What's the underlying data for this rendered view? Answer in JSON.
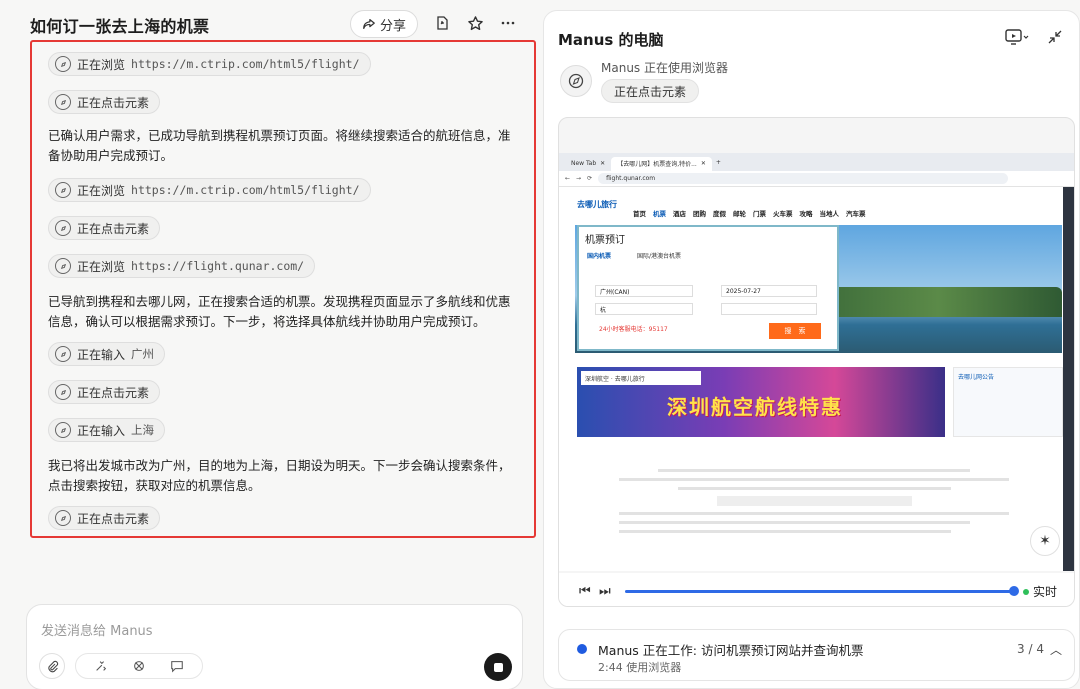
{
  "chat": {
    "title": "如何订一张去上海的机票",
    "share_label": "分享",
    "steps": [
      {
        "action": "正在浏览",
        "arg": "https://m.ctrip.com/html5/flight/"
      },
      {
        "action": "正在点击元素",
        "arg": ""
      },
      {
        "action": "正在浏览",
        "arg": "https://m.ctrip.com/html5/flight/"
      },
      {
        "action": "正在点击元素",
        "arg": ""
      },
      {
        "action": "正在浏览",
        "arg": "https://flight.qunar.com/"
      },
      {
        "action": "正在输入",
        "arg": "广州"
      },
      {
        "action": "正在点击元素",
        "arg": ""
      },
      {
        "action": "正在输入",
        "arg": "上海"
      },
      {
        "action": "正在点击元素",
        "arg": ""
      }
    ],
    "messages": [
      "已确认用户需求，已成功导航到携程机票预订页面。将继续搜索适合的航班信息，准备协助用户完成预订。",
      "已导航到携程和去哪儿网，正在搜索合适的机票。发现携程页面显示了多航线和优惠信息，确认可以根据需求预订。下一步，将选择具体航线并协助用户完成预订。",
      "我已将出发城市改为广州，目的地为上海，日期设为明天。下一步会确认搜索条件，点击搜索按钮，获取对应的机票信息。"
    ],
    "composer_placeholder": "发送消息给 Manus"
  },
  "computer": {
    "title": "Manus 的电脑",
    "agent_label": "Manus 正在使用浏览器",
    "agent_action": "正在点击元素",
    "browser": {
      "tabs": [
        "New Tab",
        "【去哪儿网】机票查询,特价..."
      ],
      "url": "flight.qunar.com",
      "logo_text": "去哪儿旅行",
      "nav": [
        "首页",
        "机票",
        "酒店",
        "团购",
        "度假",
        "邮轮",
        "门票",
        "火车票",
        "攻略",
        "当地人",
        "汽车票"
      ],
      "booking_title": "机票预订",
      "booking_tabs": [
        "国内机票",
        "国际/港澳台机票"
      ],
      "from_value": "广州(CAN)",
      "date_value": "2025-07-27",
      "to_value": "杭",
      "hotline": "24小时客服电话：95117",
      "search_label": "搜　索",
      "banner_text": "深圳航空航线特惠",
      "banner_logo": "深圳航空 · 去哪儿旅行",
      "notice_title": "去哪儿网公告"
    },
    "live_label": "实时"
  },
  "status": {
    "text": "Manus 正在工作: 访问机票预订网站并查询机票",
    "time": "2:44",
    "time_label": "使用浏览器",
    "progress": "3 / 4"
  },
  "colors": {
    "highlight_border": "#e53935",
    "accent": "#2e6ae6",
    "live_dot": "#2fbf5a"
  }
}
